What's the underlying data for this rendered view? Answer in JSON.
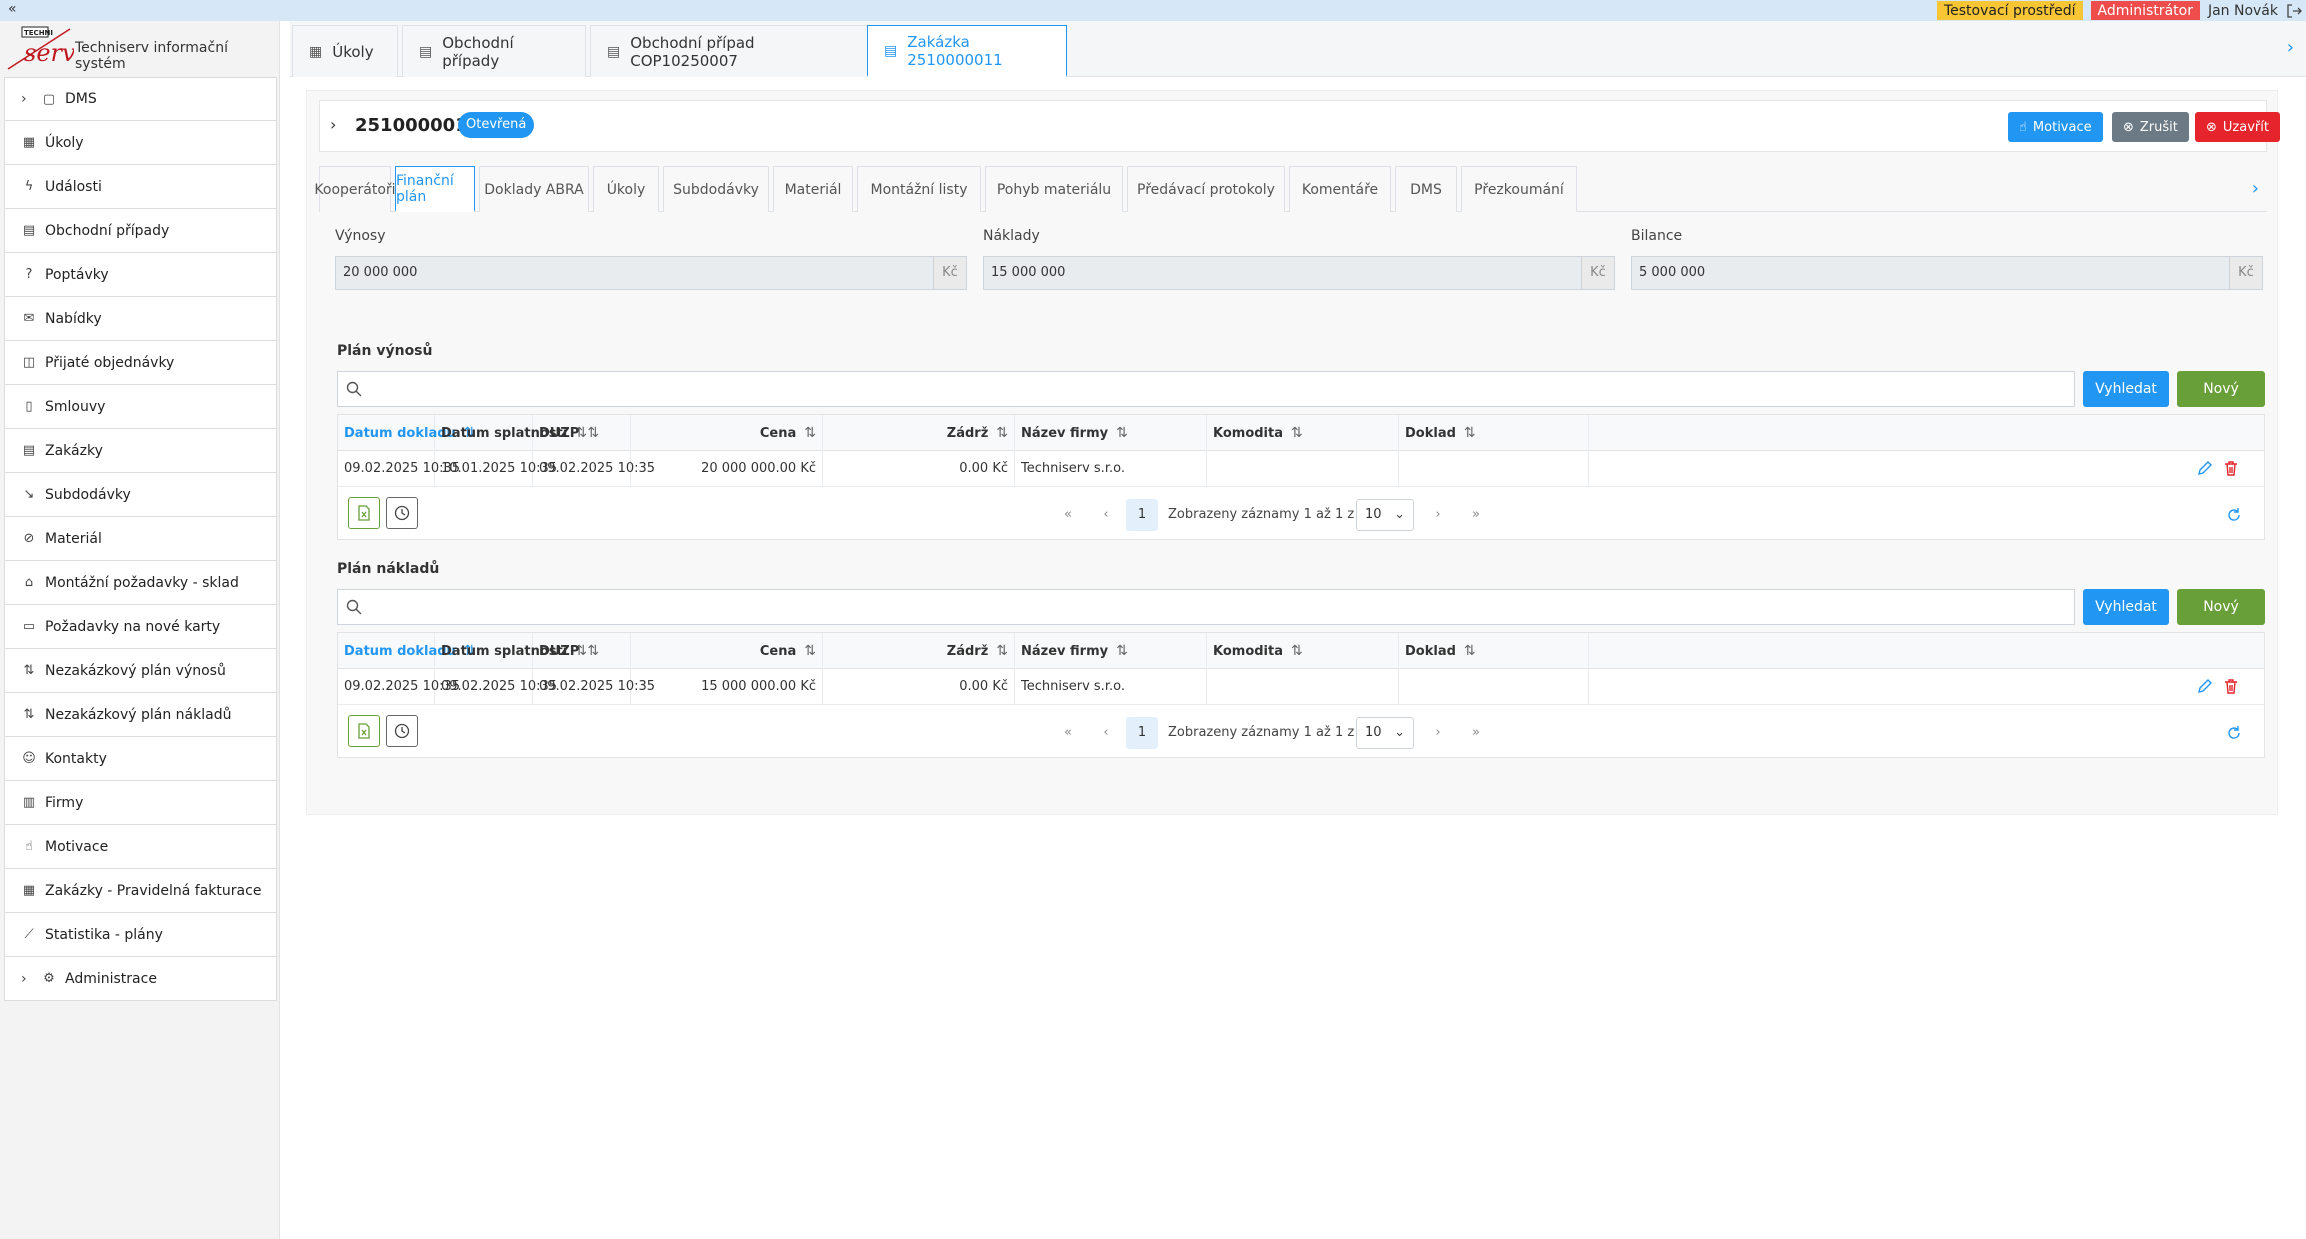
{
  "topbar": {
    "collapse_icon": "double-chevron-left-icon",
    "env_badge": "Testovací prostředí",
    "role_badge": "Administrátor",
    "user_name": "Jan Novák",
    "colors": {
      "env": "#f8c534",
      "role": "#ef4c4c",
      "bar": "#d6e8f8"
    }
  },
  "sidebar": {
    "brand_text": "Techniserv informační systém",
    "logo_text": "TECHNI serv",
    "items": [
      {
        "label": "DMS",
        "icon": "box-icon",
        "expandable": true
      },
      {
        "label": "Úkoly",
        "icon": "calendar-icon"
      },
      {
        "label": "Události",
        "icon": "bolt-icon"
      },
      {
        "label": "Obchodní případy",
        "icon": "briefcase-icon"
      },
      {
        "label": "Poptávky",
        "icon": "question-icon"
      },
      {
        "label": "Nabídky",
        "icon": "envelope-icon"
      },
      {
        "label": "Přijaté objednávky",
        "icon": "bag-icon"
      },
      {
        "label": "Smlouvy",
        "icon": "file-icon"
      },
      {
        "label": "Zakázky",
        "icon": "clipboard-icon"
      },
      {
        "label": "Subdodávky",
        "icon": "arrow-down-right-icon"
      },
      {
        "label": "Materiál",
        "icon": "paperclip-icon"
      },
      {
        "label": "Montážní požadavky - sklad",
        "icon": "home-icon"
      },
      {
        "label": "Požadavky na nové karty",
        "icon": "card-icon"
      },
      {
        "label": "Nezakázkový plán výnosů",
        "icon": "sort-amount-up-icon"
      },
      {
        "label": "Nezakázkový plán nákladů",
        "icon": "sort-amount-down-icon"
      },
      {
        "label": "Kontakty",
        "icon": "users-icon"
      },
      {
        "label": "Firmy",
        "icon": "building-icon"
      },
      {
        "label": "Motivace",
        "icon": "thumbs-up-icon"
      },
      {
        "label": "Zakázky - Pravidelná fakturace",
        "icon": "calendar-icon"
      },
      {
        "label": "Statistika - plány",
        "icon": "chart-line-icon"
      },
      {
        "label": "Administrace",
        "icon": "cog-icon",
        "expandable": true
      }
    ]
  },
  "page_tabs": [
    {
      "label": "Úkoly",
      "icon": "calendar-icon"
    },
    {
      "label": "Obchodní případy",
      "icon": "briefcase-icon"
    },
    {
      "label": "Obchodní případ COP10250007",
      "icon": "briefcase-icon"
    },
    {
      "label": "Zakázka 2510000011",
      "icon": "clipboard-icon",
      "active": true
    }
  ],
  "record": {
    "id": "2510000011",
    "status": "Otevřená",
    "buttons": {
      "motivace": "Motivace",
      "zrusit": "Zrušit",
      "uzavrit": "Uzavřít"
    }
  },
  "sub_tabs": [
    {
      "label": "Kooperátoři"
    },
    {
      "label": "Finanční plán",
      "active": true
    },
    {
      "label": "Doklady ABRA"
    },
    {
      "label": "Úkoly"
    },
    {
      "label": "Subdodávky"
    },
    {
      "label": "Materiál"
    },
    {
      "label": "Montážní listy"
    },
    {
      "label": "Pohyb materiálu"
    },
    {
      "label": "Předávací protokoly"
    },
    {
      "label": "Komentáře"
    },
    {
      "label": "DMS"
    },
    {
      "label": "Přezkoumání"
    }
  ],
  "summary": {
    "vynosy": {
      "label": "Výnosy",
      "value": "20 000 000",
      "unit": "Kč"
    },
    "naklady": {
      "label": "Náklady",
      "value": "15 000 000",
      "unit": "Kč"
    },
    "bilance": {
      "label": "Bilance",
      "value": "5 000 000",
      "unit": "Kč"
    }
  },
  "columns": [
    "Datum dokladu",
    "Datum splatnosti",
    "DUZP",
    "Cena",
    "Zádrž",
    "Název firmy",
    "Komodita",
    "Doklad"
  ],
  "revenue_plan": {
    "title": "Plán výnosů",
    "search_placeholder": "",
    "search_button": "Vyhledat",
    "new_button": "Nový",
    "row": {
      "datum_dokladu": "09.02.2025 10:35",
      "datum_splatnosti": "10.01.2025 10:35",
      "duzp": "09.02.2025 10:35",
      "cena": "20 000 000.00 Kč",
      "zadrz": "0.00 Kč",
      "nazev_firmy": "Techniserv s.r.o.",
      "komodita": "",
      "doklad": ""
    },
    "pager": {
      "current_page": "1",
      "info": "Zobrazeny záznamy 1 až 1 z 1",
      "page_size": "10"
    }
  },
  "cost_plan": {
    "title": "Plán nákladů",
    "search_placeholder": "",
    "search_button": "Vyhledat",
    "new_button": "Nový",
    "row": {
      "datum_dokladu": "09.02.2025 10:35",
      "datum_splatnosti": "09.02.2025 10:35",
      "duzp": "09.02.2025 10:35",
      "cena": "15 000 000.00 Kč",
      "zadrz": "0.00 Kč",
      "nazev_firmy": "Techniserv s.r.o.",
      "komodita": "",
      "doklad": ""
    },
    "pager": {
      "current_page": "1",
      "info": "Zobrazeny záznamy 1 až 1 z 1",
      "page_size": "10"
    }
  },
  "colors": {
    "primary": "#2196f3",
    "success": "#689f38",
    "danger": "#e5242b",
    "secondary": "#6c7a86"
  }
}
